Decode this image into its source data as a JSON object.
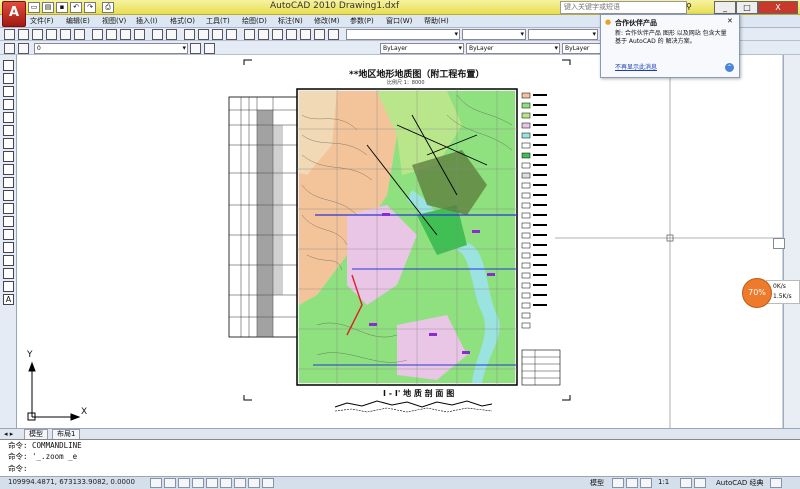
{
  "window": {
    "title": "AutoCAD 2010      Drawing1.dxf",
    "search_placeholder": "键入关键字或短语",
    "min_label": "_",
    "max_label": "□",
    "close_label": "X",
    "app_logo": "A"
  },
  "quick_access": [
    "new-icon",
    "open-icon",
    "save-icon",
    "undo-icon",
    "redo-icon",
    "print-icon"
  ],
  "menu": [
    "文件(F)",
    "编辑(E)",
    "视图(V)",
    "插入(I)",
    "格式(O)",
    "工具(T)",
    "绘图(D)",
    "标注(N)",
    "修改(M)",
    "参数(P)",
    "窗口(W)",
    "帮助(H)"
  ],
  "toolbar2": {
    "layer_value": "0",
    "color_value": "ByLayer",
    "linetype_value": "ByLayer",
    "lineweight_value": "ByLayer"
  },
  "balloon": {
    "title": "合作伙伴产品",
    "body": "新: 合作伙伴产品 图形 以及网站 包含大量基于 AutoCAD 的 解决方案。",
    "link": "不再显示此消息"
  },
  "drawing": {
    "title": "**地区地形地质图（附工程布置）",
    "scale": "比例尺  1：8000",
    "section_title": "I - I'  地  质  剖  面  图",
    "ucs_x": "X",
    "ucs_y": "Y"
  },
  "tabs": [
    "模型",
    "布局1"
  ],
  "command_lines": [
    "命令: COMMANDLINE",
    "命令: '_.zoom _e",
    "命令:"
  ],
  "status": {
    "coords": "109994.4871,  673133.9082,  0.0000",
    "model_label": "模型",
    "scale_label": "1:1",
    "workspace": "AutoCAD 经典"
  },
  "net_meter": {
    "percent": "70%",
    "up": "0K/s",
    "down": "1.5K/s"
  },
  "colors": {
    "titlebar": "#e8df4f",
    "map_green": "#8fe07f",
    "map_peach": "#f3c49a",
    "map_pink": "#e9c6e6",
    "map_water": "#9be3e0"
  }
}
